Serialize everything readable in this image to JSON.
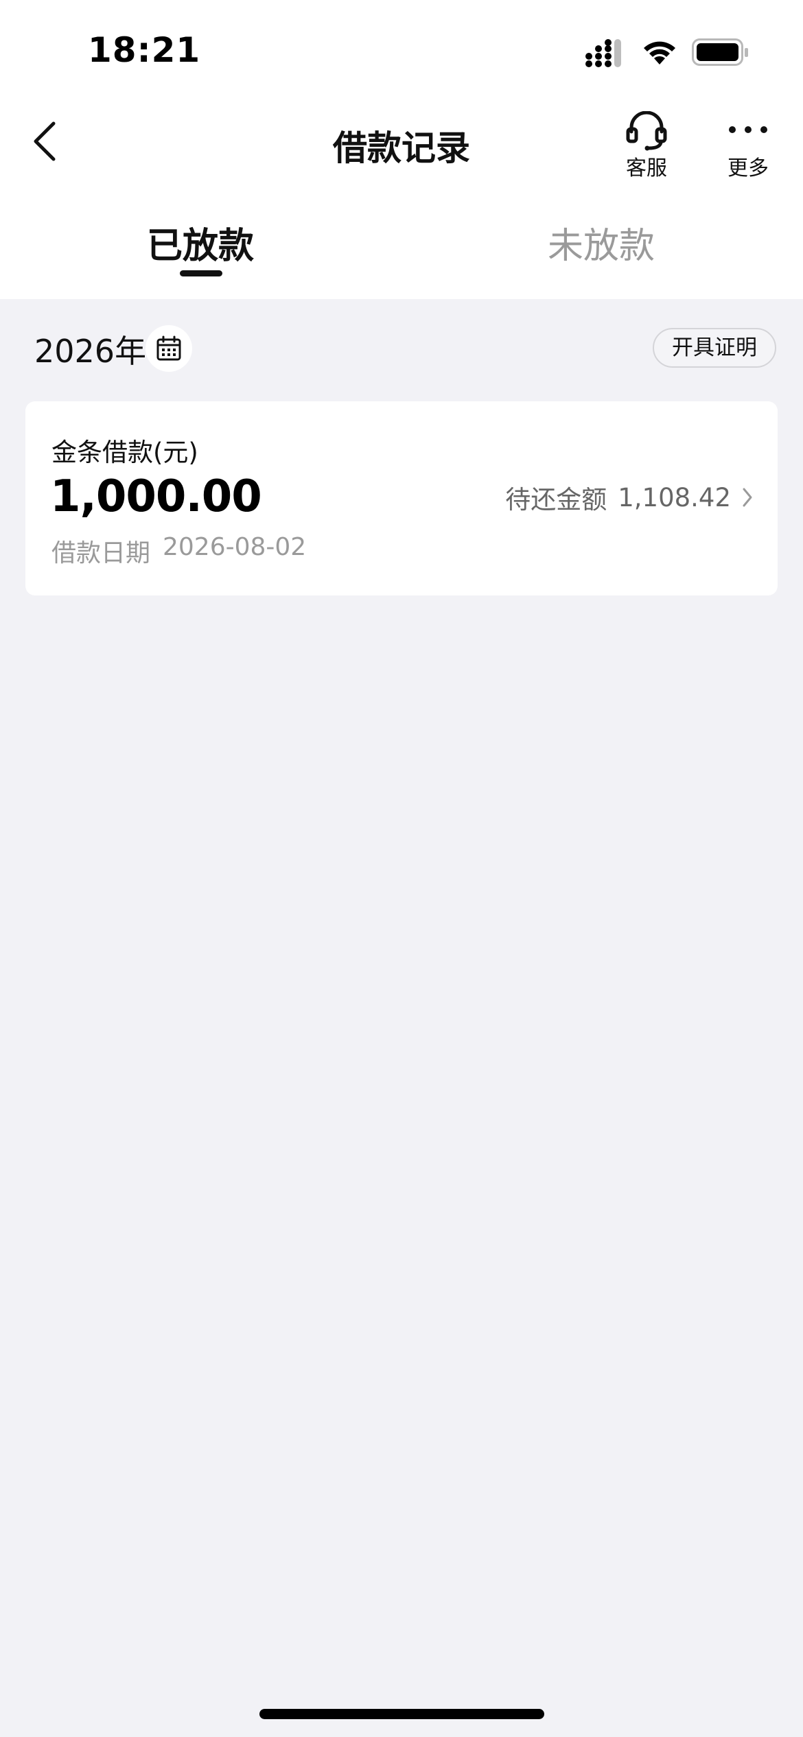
{
  "status_bar": {
    "time": "18:21"
  },
  "nav": {
    "title": "借款记录",
    "customer_service_label": "客服",
    "more_label": "更多"
  },
  "tabs": [
    {
      "label": "已放款",
      "active": true
    },
    {
      "label": "未放款",
      "active": false
    }
  ],
  "filter": {
    "year": "2026年",
    "certificate_button": "开具证明"
  },
  "loans": [
    {
      "product": "金条借款(元)",
      "amount": "1,000.00",
      "date_label": "借款日期",
      "date": "2026-08-02",
      "due_label": "待还金额",
      "due_amount": "1,108.42"
    }
  ],
  "colors": {
    "background": "#f2f2f6",
    "surface": "#ffffff",
    "primary_text": "#111111",
    "secondary_text": "#9a9a9a"
  }
}
